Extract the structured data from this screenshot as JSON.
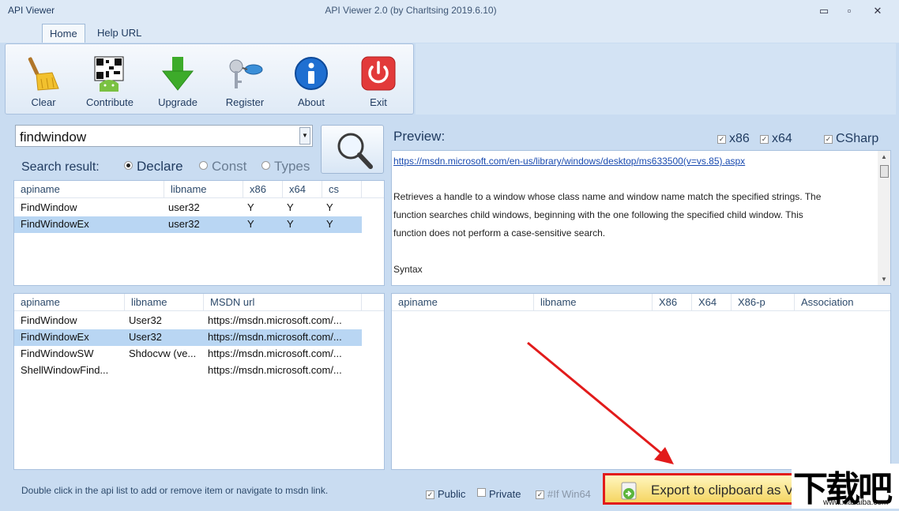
{
  "window": {
    "app_name": "API Viewer",
    "title": "API Viewer 2.0 (by Charltsing 2019.6.10)",
    "minimize": "▭",
    "restore": "▫",
    "close": "✕"
  },
  "tabs": [
    {
      "label": "Home",
      "active": true
    },
    {
      "label": "Help URL",
      "active": false
    }
  ],
  "ribbon": [
    {
      "label": "Clear",
      "icon": "broom-icon"
    },
    {
      "label": "Contribute",
      "icon": "qr-code-icon"
    },
    {
      "label": "Upgrade",
      "icon": "down-arrow-icon"
    },
    {
      "label": "Register",
      "icon": "key-icon"
    },
    {
      "label": "About",
      "icon": "info-icon"
    },
    {
      "label": "Exit",
      "icon": "power-icon"
    }
  ],
  "search": {
    "value": "findwindow",
    "result_label": "Search result:",
    "options": [
      {
        "label": "Declare",
        "selected": true
      },
      {
        "label": "Const",
        "selected": false
      },
      {
        "label": "Types",
        "selected": false
      }
    ]
  },
  "results_table": {
    "columns": [
      "apiname",
      "libname",
      "x86",
      "x64",
      "cs"
    ],
    "rows": [
      {
        "apiname": "FindWindow",
        "libname": "user32",
        "x86": "Y",
        "x64": "Y",
        "cs": "Y",
        "selected": false
      },
      {
        "apiname": "FindWindowEx",
        "libname": "user32",
        "x86": "Y",
        "x64": "Y",
        "cs": "Y",
        "selected": true
      }
    ]
  },
  "msdn_table": {
    "columns": [
      "apiname",
      "libname",
      "MSDN url"
    ],
    "rows": [
      {
        "apiname": "FindWindow",
        "libname": "User32",
        "url": "https://msdn.microsoft.com/...",
        "selected": false
      },
      {
        "apiname": "FindWindowEx",
        "libname": "User32",
        "url": "https://msdn.microsoft.com/...",
        "selected": true
      },
      {
        "apiname": "FindWindowSW",
        "libname": "Shdocvw (ve...",
        "url": "https://msdn.microsoft.com/...",
        "selected": false
      },
      {
        "apiname": "ShellWindowFind...",
        "libname": "",
        "url": "https://msdn.microsoft.com/...",
        "selected": false
      }
    ]
  },
  "preview": {
    "label": "Preview:",
    "checks": [
      {
        "label": "x86",
        "checked": true
      },
      {
        "label": "x64",
        "checked": true
      },
      {
        "label": "CSharp",
        "checked": true
      }
    ],
    "link": "https://msdn.microsoft.com/en-us/library/windows/desktop/ms633500(v=vs.85).aspx",
    "lines": [
      "Retrieves a handle to a window whose class name and window name match the specified strings. The",
      "function searches child windows, beginning with the one following the specified child window. This",
      "function does not perform a case-sensitive search."
    ],
    "syntax_label": "Syntax"
  },
  "assoc_table": {
    "columns": [
      "apiname",
      "libname",
      "X86",
      "X64",
      "X86-p",
      "Association"
    ]
  },
  "status": "Double click in the api list to add or remove item or navigate to msdn link.",
  "bottom_checks": [
    {
      "label": "Public",
      "checked": true
    },
    {
      "label": "Private",
      "checked": false
    },
    {
      "label": "#If Win64",
      "checked": true,
      "disabled": true
    }
  ],
  "export_button": "Export to clipboard as V",
  "watermark": {
    "logo": "下载吧",
    "site": "www.xiazaiba.com"
  }
}
